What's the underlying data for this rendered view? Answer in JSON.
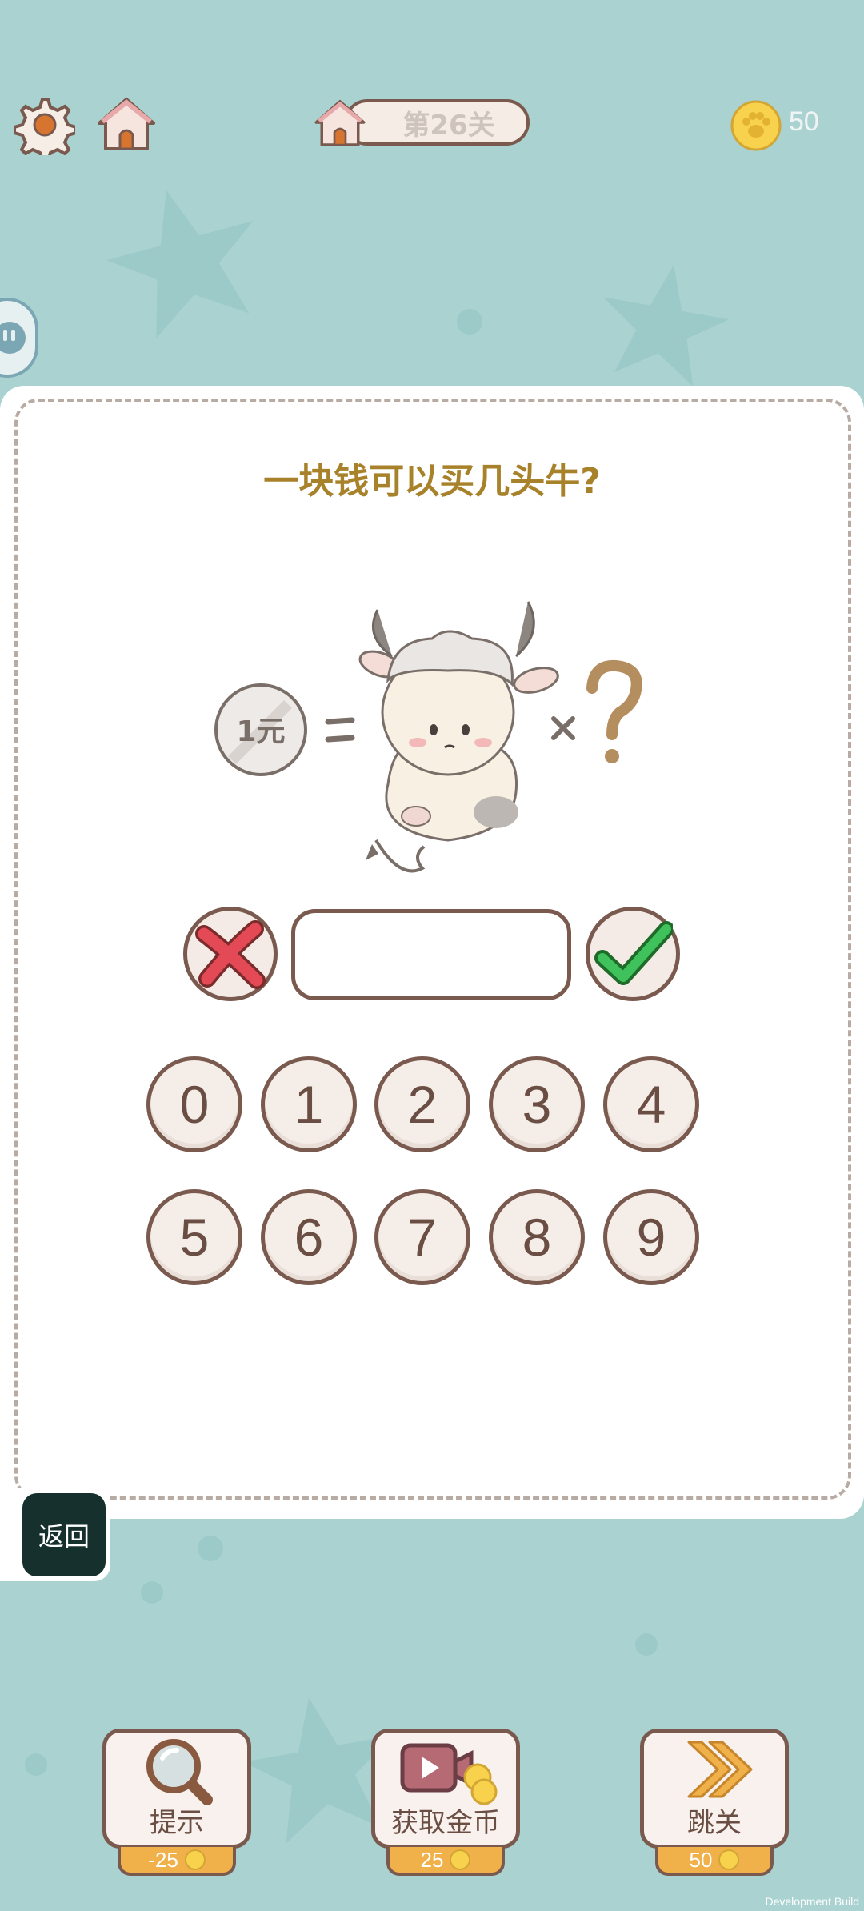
{
  "header": {
    "level_label": "第26关",
    "coin_count": "50"
  },
  "puzzle": {
    "question": "一块钱可以买几头牛?",
    "coin_label": "1元",
    "answer_value": ""
  },
  "keypad": {
    "keys": [
      "0",
      "1",
      "2",
      "3",
      "4",
      "5",
      "6",
      "7",
      "8",
      "9"
    ]
  },
  "back": {
    "label": "返回"
  },
  "tools": {
    "hint": {
      "label": "提示",
      "cost": "-25"
    },
    "get_coins": {
      "label": "获取金币",
      "cost": "25"
    },
    "skip": {
      "label": "跳关",
      "cost": "50"
    }
  },
  "footer": {
    "dev_label": "Development Build"
  },
  "colors": {
    "background": "#a9d2d1",
    "brown": "#7a5a4e",
    "question_gold": "#a8822a",
    "coin_yellow": "#f8d24c",
    "cost_orange": "#f0b04a"
  }
}
